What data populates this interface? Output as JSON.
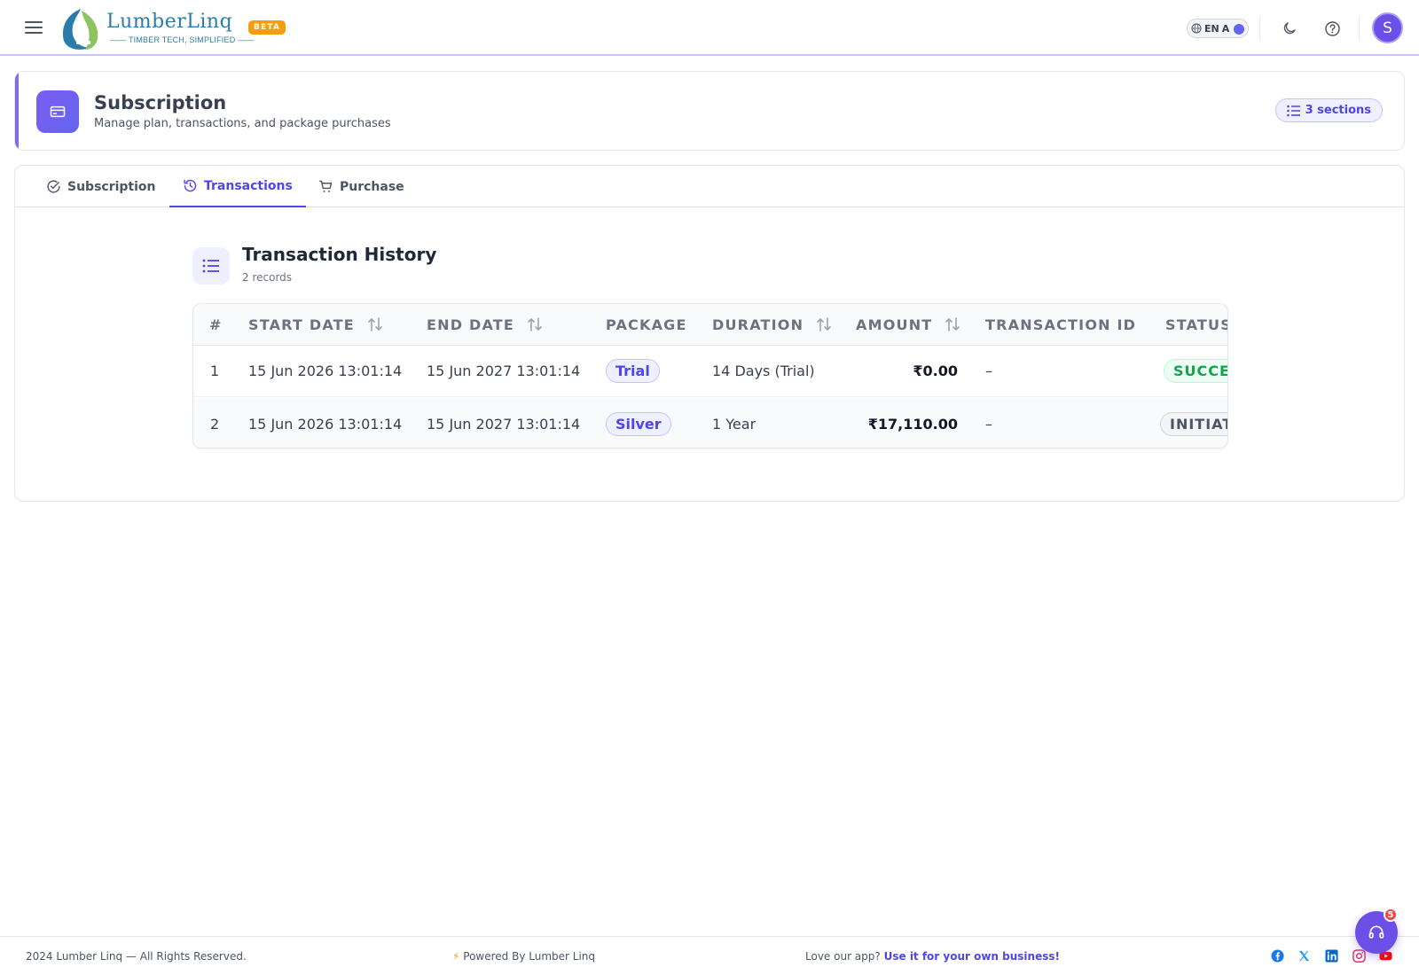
{
  "header": {
    "brand_name": "LumberLinq",
    "brand_tagline": "TIMBER TECH, SIMPLIFIED",
    "beta_badge": "BETA",
    "language": "EN",
    "language_script": "A",
    "avatar_initial": "S",
    "accent_color": "#6c4fe6"
  },
  "page": {
    "title": "Subscription",
    "subtitle": "Manage plan, transactions, and package purchases",
    "sections_badge": "3 sections"
  },
  "tabs": [
    {
      "label": "Subscription",
      "icon": "check-circle-icon",
      "active": false
    },
    {
      "label": "Transactions",
      "icon": "history-icon",
      "active": true
    },
    {
      "label": "Purchase",
      "icon": "cart-icon",
      "active": false
    }
  ],
  "transactions": {
    "title": "Transaction History",
    "record_count": "2 records",
    "columns": [
      "#",
      "START DATE",
      "END DATE",
      "PACKAGE",
      "DURATION",
      "AMOUNT",
      "TRANSACTION ID",
      "STATUS"
    ],
    "rows": [
      {
        "index": "1",
        "start_date": "15 Jun 2026 13:01:14",
        "end_date": "15 Jun 2027 13:01:14",
        "package": "Trial",
        "duration": "14 Days (Trial)",
        "amount": "₹0.00",
        "transaction_id": "–",
        "status": "SUCCESS",
        "status_color": "#16a34a"
      },
      {
        "index": "2",
        "start_date": "15 Jun 2026 13:01:14",
        "end_date": "15 Jun 2027 13:01:14",
        "package": "Silver",
        "duration": "1 Year",
        "amount": "₹17,110.00",
        "transaction_id": "–",
        "status": "INITIATED",
        "status_color": "#4b5563"
      }
    ]
  },
  "footer": {
    "copyright": "2024 Lumber Linq — All Rights Reserved.",
    "powered_by": "Powered By Lumber Linq",
    "promo_text": "Love our app?",
    "promo_link": "Use it for your own business!",
    "social": [
      "facebook-icon",
      "x-icon",
      "linkedin-icon",
      "instagram-icon",
      "youtube-icon"
    ],
    "support_badge_count": "5"
  }
}
